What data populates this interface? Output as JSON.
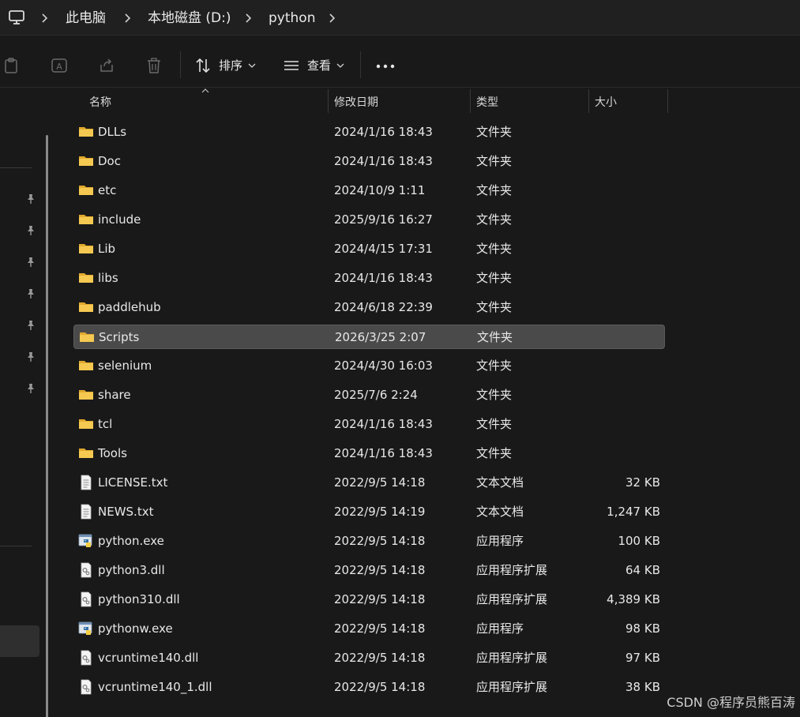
{
  "breadcrumb": {
    "icon": "monitor-icon",
    "items": [
      "此电脑",
      "本地磁盘 (D:)",
      "python"
    ]
  },
  "toolbar": {
    "sort_label": "排序",
    "view_label": "查看",
    "more_label": "•••"
  },
  "columns": {
    "name": "名称",
    "date": "修改日期",
    "type": "类型",
    "size": "大小"
  },
  "files": [
    {
      "name": "DLLs",
      "date": "2024/1/16 18:43",
      "type": "文件夹",
      "size": "",
      "icon": "folder-icon"
    },
    {
      "name": "Doc",
      "date": "2024/1/16 18:43",
      "type": "文件夹",
      "size": "",
      "icon": "folder-icon"
    },
    {
      "name": "etc",
      "date": "2024/10/9 1:11",
      "type": "文件夹",
      "size": "",
      "icon": "folder-icon"
    },
    {
      "name": "include",
      "date": "2025/9/16 16:27",
      "type": "文件夹",
      "size": "",
      "icon": "folder-icon"
    },
    {
      "name": "Lib",
      "date": "2024/4/15 17:31",
      "type": "文件夹",
      "size": "",
      "icon": "folder-icon"
    },
    {
      "name": "libs",
      "date": "2024/1/16 18:43",
      "type": "文件夹",
      "size": "",
      "icon": "folder-icon"
    },
    {
      "name": "paddlehub",
      "date": "2024/6/18 22:39",
      "type": "文件夹",
      "size": "",
      "icon": "folder-icon"
    },
    {
      "name": "Scripts",
      "date": "2026/3/25 2:07",
      "type": "文件夹",
      "size": "",
      "icon": "folder-icon"
    },
    {
      "name": "selenium",
      "date": "2024/4/30 16:03",
      "type": "文件夹",
      "size": "",
      "icon": "folder-icon"
    },
    {
      "name": "share",
      "date": "2025/7/6 2:24",
      "type": "文件夹",
      "size": "",
      "icon": "folder-icon"
    },
    {
      "name": "tcl",
      "date": "2024/1/16 18:43",
      "type": "文件夹",
      "size": "",
      "icon": "folder-icon"
    },
    {
      "name": "Tools",
      "date": "2024/1/16 18:43",
      "type": "文件夹",
      "size": "",
      "icon": "folder-icon"
    },
    {
      "name": "LICENSE.txt",
      "date": "2022/9/5 14:18",
      "type": "文本文档",
      "size": "32 KB",
      "icon": "text-file-icon"
    },
    {
      "name": "NEWS.txt",
      "date": "2022/9/5 14:19",
      "type": "文本文档",
      "size": "1,247 KB",
      "icon": "text-file-icon"
    },
    {
      "name": "python.exe",
      "date": "2022/9/5 14:18",
      "type": "应用程序",
      "size": "100 KB",
      "icon": "python-exe-icon"
    },
    {
      "name": "python3.dll",
      "date": "2022/9/5 14:18",
      "type": "应用程序扩展",
      "size": "64 KB",
      "icon": "dll-file-icon"
    },
    {
      "name": "python310.dll",
      "date": "2022/9/5 14:18",
      "type": "应用程序扩展",
      "size": "4,389 KB",
      "icon": "dll-file-icon"
    },
    {
      "name": "pythonw.exe",
      "date": "2022/9/5 14:18",
      "type": "应用程序",
      "size": "98 KB",
      "icon": "python-exe-icon"
    },
    {
      "name": "vcruntime140.dll",
      "date": "2022/9/5 14:18",
      "type": "应用程序扩展",
      "size": "97 KB",
      "icon": "dll-file-icon"
    },
    {
      "name": "vcruntime140_1.dll",
      "date": "2022/9/5 14:18",
      "type": "应用程序扩展",
      "size": "38 KB",
      "icon": "dll-file-icon"
    }
  ],
  "selected_file": "Scripts",
  "watermark": "CSDN @程序员熊百涛",
  "colors": {
    "background": "#191919",
    "selected_row": "#4a4a4a",
    "folder": "#f2c94c"
  }
}
